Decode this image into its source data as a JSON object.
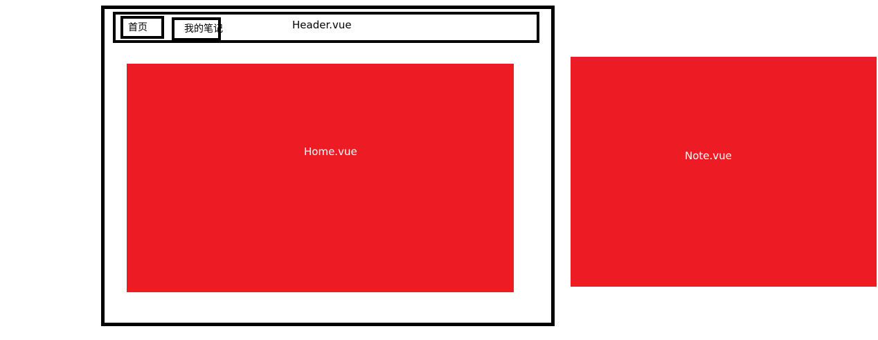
{
  "header": {
    "label": "Header.vue",
    "nav": {
      "home_label": "首页",
      "note_label": "我的笔记"
    }
  },
  "home": {
    "label": "Home.vue"
  },
  "note": {
    "label": "Note.vue"
  },
  "colors": {
    "panel_fill": "#ed1c24",
    "panel_text": "#ffffff",
    "border": "#000000",
    "background": "#ffffff"
  }
}
